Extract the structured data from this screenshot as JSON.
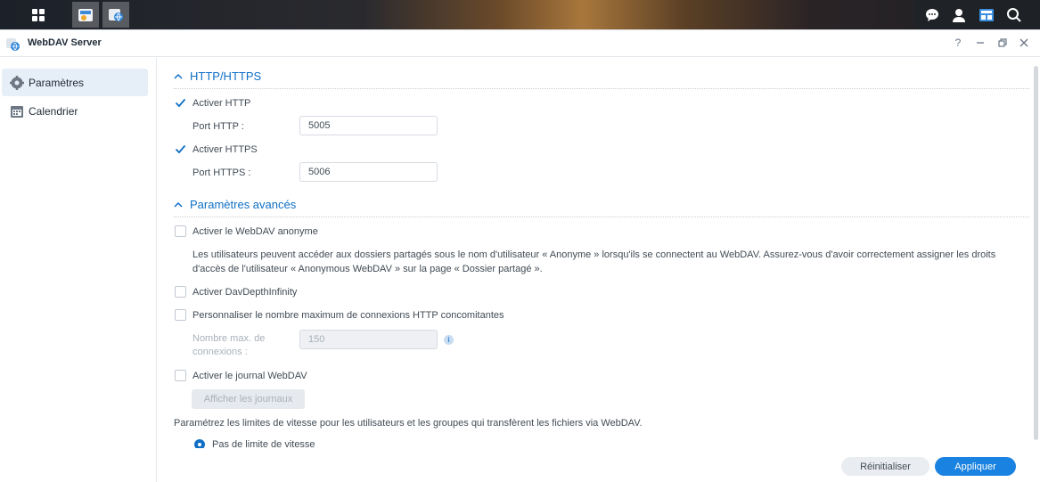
{
  "window": {
    "title": "WebDAV Server"
  },
  "sidebar": {
    "items": [
      {
        "label": "Paramètres",
        "icon": "gear-icon",
        "active": true
      },
      {
        "label": "Calendrier",
        "icon": "calendar-icon",
        "active": false
      }
    ]
  },
  "http": {
    "section_title": "HTTP/HTTPS",
    "enable_http_label": "Activer HTTP",
    "enable_http_checked": true,
    "port_http_label": "Port HTTP :",
    "port_http_value": "5005",
    "enable_https_label": "Activer HTTPS",
    "enable_https_checked": true,
    "port_https_label": "Port HTTPS :",
    "port_https_value": "5006"
  },
  "advanced": {
    "section_title": "Paramètres avancés",
    "anonymous_label": "Activer le WebDAV anonyme",
    "anonymous_desc_line1": "Les utilisateurs peuvent accéder aux dossiers partagés sous le nom d'utilisateur « Anonyme » lorsqu'ils se connectent au WebDAV. Assurez-vous d'avoir correctement assigner les droits",
    "anonymous_desc_line2": "d'accès de l'utilisateur « Anonymous WebDAV » sur la page « Dossier partagé ».",
    "depth_label": "Activer DavDepthInfinity",
    "max_conn_label": "Personnaliser le nombre maximum de connexions HTTP concomitantes",
    "max_conn_field_label_1": "Nombre max. de",
    "max_conn_field_label_2": "connexions :",
    "max_conn_value": "150",
    "log_label": "Activer le journal WebDAV",
    "show_logs_button": "Afficher les journaux",
    "speed_desc": "Paramétrez les limites de vitesse pour les utilisateurs et les groupes qui transfèrent les fichiers via WebDAV.",
    "no_limit_label": "Pas de limite de vitesse"
  },
  "footer": {
    "reset_label": "Réinitialiser",
    "apply_label": "Appliquer"
  },
  "colors": {
    "accent": "#0f6fc6",
    "primary_button": "#1a82e0"
  }
}
